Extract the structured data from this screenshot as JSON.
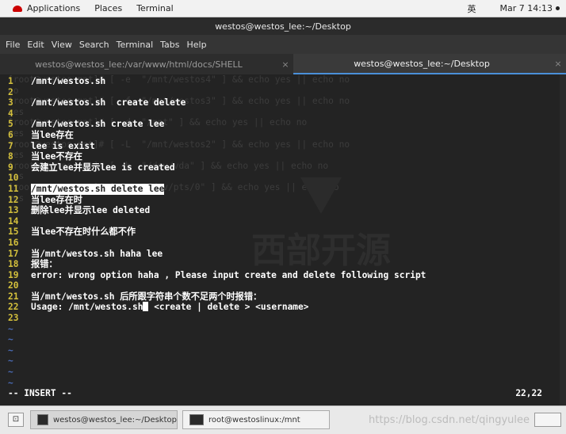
{
  "topbar": {
    "applications": "Applications",
    "places": "Places",
    "terminal": "Terminal",
    "ime": "英",
    "datetime": "Mar 7 14:13"
  },
  "window": {
    "title": "westos@westos_lee:~/Desktop"
  },
  "menubar": [
    "File",
    "Edit",
    "View",
    "Search",
    "Terminal",
    "Tabs",
    "Help"
  ],
  "tabs": [
    {
      "label": "westos@westos_lee:/var/www/html/docs/SHELL",
      "close": "×"
    },
    {
      "label": "westos@westos_lee:~/Desktop",
      "close": "×"
    }
  ],
  "ghost_lines": [
    "[root@westos mnt]# [ -e  \"/mnt/westos4\" ] && echo yes || echo no",
    "no",
    "[root@westos mnt]# [ -f  \"/mnt/westos3\" ] && echo yes || echo no",
    "yes",
    "[root@westos mnt]# [ -d  \"/mnt\" ] && echo yes || echo no",
    "yes",
    "[root@westos mnt]# [ -L  \"/mnt/westos2\" ] && echo yes || echo no",
    "yes",
    "[root@westos mnt]# [ -b  \"/dev/vda\" ] && echo yes || echo no",
    "yes",
    "[root@westos mnt]# [ -c  \"/dev/pts/0\" ] && echo yes || echo no",
    "yes"
  ],
  "editor_lines": [
    {
      "n": "1",
      "text": "/mnt/westos.sh"
    },
    {
      "n": "2",
      "text": ""
    },
    {
      "n": "3",
      "text": "/mnt/westos.sh  create delete"
    },
    {
      "n": "4",
      "text": ""
    },
    {
      "n": "5",
      "text": "/mnt/westos.sh create lee"
    },
    {
      "n": "6",
      "text": "当lee存在"
    },
    {
      "n": "7",
      "text": "lee is exist"
    },
    {
      "n": "8",
      "text": "当lee不存在"
    },
    {
      "n": "9",
      "text": "会建立lee并显示lee is created"
    },
    {
      "n": "10",
      "text": ""
    },
    {
      "n": "11",
      "text": "/mnt/westos.sh delete lee"
    },
    {
      "n": "12",
      "text": "当lee存在时"
    },
    {
      "n": "13",
      "text": "删除lee并显示lee deleted"
    },
    {
      "n": "14",
      "text": ""
    },
    {
      "n": "15",
      "text": "当lee不存在时什么都不作"
    },
    {
      "n": "16",
      "text": ""
    },
    {
      "n": "17",
      "text": "当/mnt/westos.sh haha lee"
    },
    {
      "n": "18",
      "text": "报错："
    },
    {
      "n": "19",
      "text": "error: wrong option haha , Please input create and delete following script"
    },
    {
      "n": "20",
      "text": ""
    },
    {
      "n": "21",
      "text": "当/mnt/westos.sh 后所跟字符串个数不足两个时报错："
    },
    {
      "n": "22",
      "text_before": "Usage: /mnt/westos.sh",
      "text_after": " <create | delete > <username>"
    },
    {
      "n": "23",
      "text": ""
    }
  ],
  "tildes": [
    "~",
    "~",
    "~",
    "~",
    "~",
    "~"
  ],
  "status": {
    "mode": "-- INSERT --",
    "position": "22,22"
  },
  "taskbar": {
    "tasks": [
      "westos@westos_lee:~/Desktop",
      "root@westoslinux:/mnt"
    ],
    "watermark": "https://blog.csdn.net/qingyulee"
  },
  "watermark_text": "西部开源"
}
